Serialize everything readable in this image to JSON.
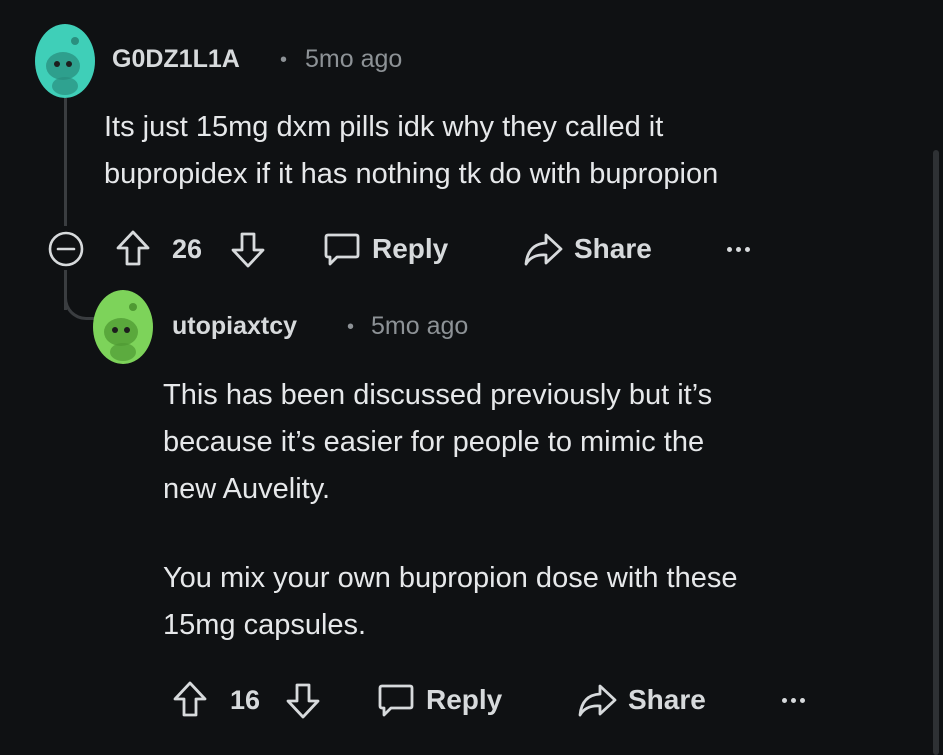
{
  "comments": [
    {
      "username": "G0DZ1L1A",
      "separator": "•",
      "time": "5mo ago",
      "body_lines": [
        "Its just 15mg dxm pills idk why they called it",
        "bupropidex if it has nothing tk do with bupropion"
      ],
      "score": "26",
      "reply_label": "Reply",
      "share_label": "Share",
      "avatar_color": "#3fcfb8"
    },
    {
      "username": "utopiaxtcy",
      "separator": "•",
      "time": "5mo ago",
      "body_lines": [
        "This has been discussed previously but it’s",
        "because it’s easier for people to mimic the",
        "new Auvelity.",
        "",
        "You mix your own bupropion dose with these",
        "15mg capsules."
      ],
      "score": "16",
      "reply_label": "Reply",
      "share_label": "Share",
      "avatar_color": "#7dd35a"
    }
  ],
  "icons": {
    "collapse": "collapse-minus-icon",
    "upvote": "upvote-arrow-icon",
    "downvote": "downvote-arrow-icon",
    "reply": "speech-bubble-icon",
    "share": "share-arrow-icon",
    "more": "more-dots-icon"
  },
  "colors": {
    "background": "#0f1113",
    "text": "#e6e8ea",
    "muted": "#8d9296"
  }
}
